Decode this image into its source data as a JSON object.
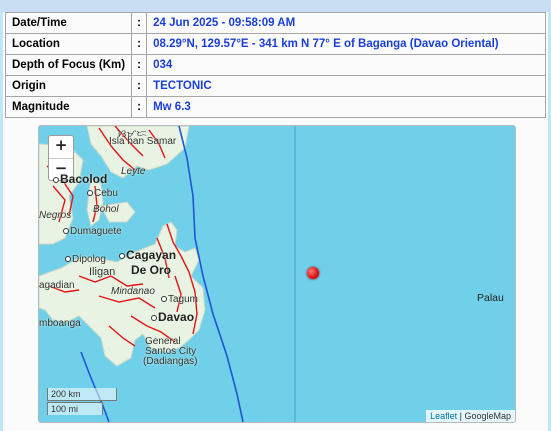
{
  "info": {
    "rows": [
      {
        "label": "Date/Time",
        "value": "24 Jun 2025 - 09:58:09 AM"
      },
      {
        "label": "Location",
        "value": "08.29°N, 129.57°E - 341 km N 77° E of Baganga (Davao Oriental)"
      },
      {
        "label": "Depth of Focus (Km)",
        "value": "034"
      },
      {
        "label": "Origin",
        "value": "TECTONIC"
      },
      {
        "label": "Magnitude",
        "value": "Mw 6.3"
      }
    ],
    "colon": ":"
  },
  "map": {
    "zoom_in": "+",
    "zoom_out": "−",
    "scale_km": "200 km",
    "scale_mi": "100 mi",
    "attribution_leaflet": "Leaflet",
    "attribution_sep": " | ",
    "attribution_google": "GoogleMap",
    "labels": {
      "samar_top": "ᜐᜋᜇ",
      "samar": "Isla han Samar",
      "leyte": "Leyte",
      "bacolod": "Bacolod",
      "cebu": "Cebu",
      "bohol": "Bohol",
      "negros": "Negros",
      "dumaguete": "Dumaguete",
      "dipolog": "Dipolog",
      "iligan": "Iligan",
      "cagayan": "Cagayan",
      "deoro": "De Oro",
      "mindanao": "Mindanao",
      "pagadian": "agadian",
      "tagum": "Tagum",
      "davao": "Davao",
      "zamboanga": "mboanga",
      "general": "General",
      "santos": "Santos City",
      "dadiangas": "(Dadiangas)",
      "palau": "Palau"
    },
    "colors": {
      "sea": "#70d0e9",
      "land": "#e9f3e4",
      "faults": "#e01414",
      "trench": "#1f55d6",
      "epicenter": "#e00000"
    }
  }
}
